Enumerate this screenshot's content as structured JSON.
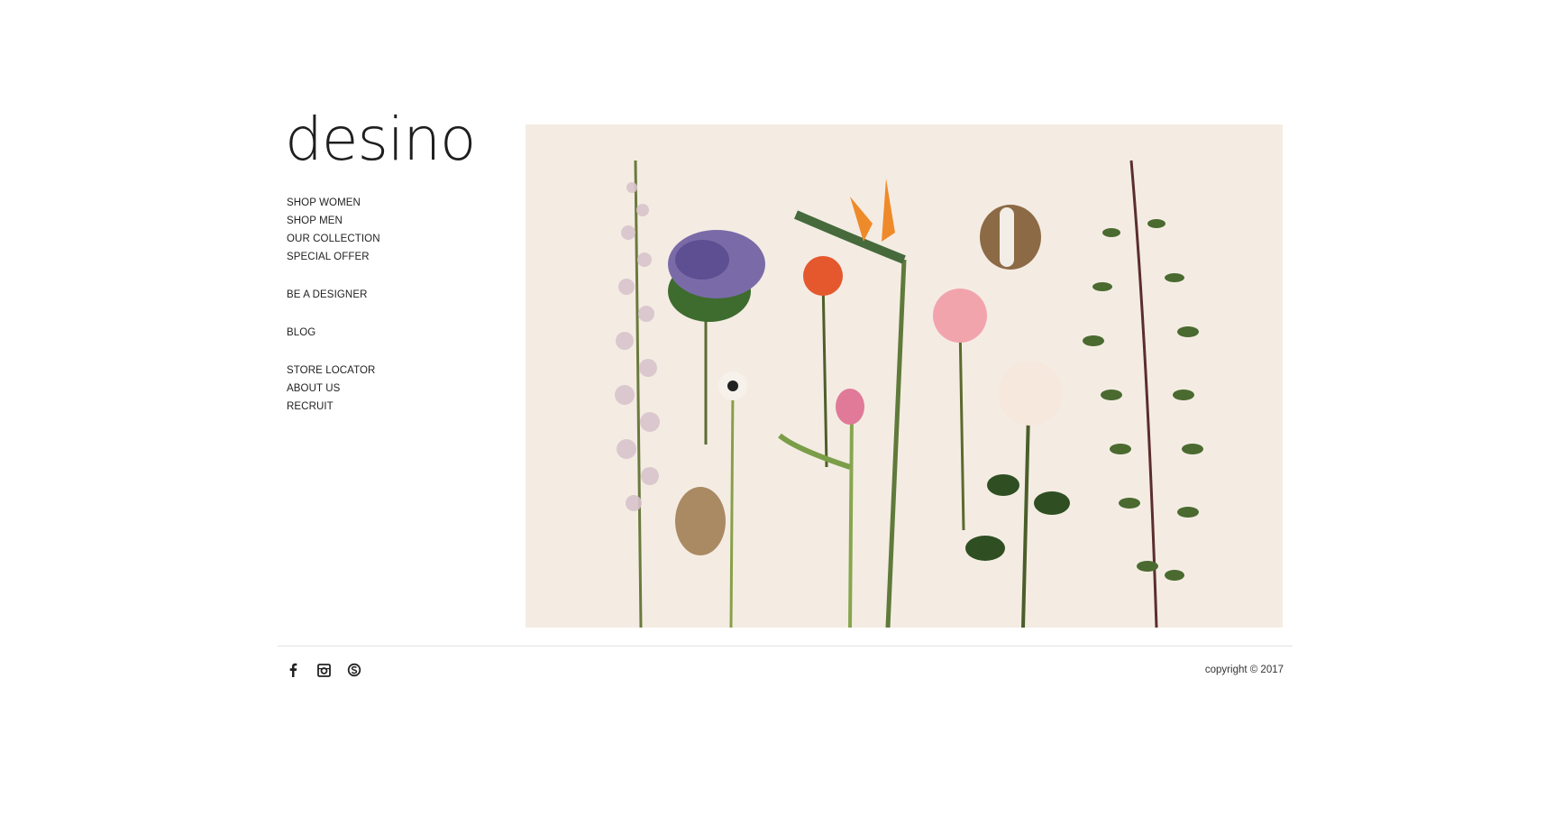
{
  "brand": {
    "logo": "desino"
  },
  "nav": {
    "groups": [
      {
        "items": [
          "SHOP WOMEN",
          "SHOP MEN",
          "OUR COLLECTION",
          "SPECIAL OFFER"
        ]
      },
      {
        "items": [
          "BE A DESIGNER"
        ]
      },
      {
        "items": [
          "BLOG"
        ]
      },
      {
        "items": [
          "STORE LOCATOR",
          "ABOUT US",
          "RECRUIT"
        ]
      }
    ]
  },
  "hero": {
    "image": "flowers-flatlay-photo",
    "background_color": "#f4ece3"
  },
  "footer": {
    "social_icons": [
      "facebook-icon",
      "instagram-icon",
      "skype-icon"
    ],
    "copyright": "copyright © 2017"
  }
}
